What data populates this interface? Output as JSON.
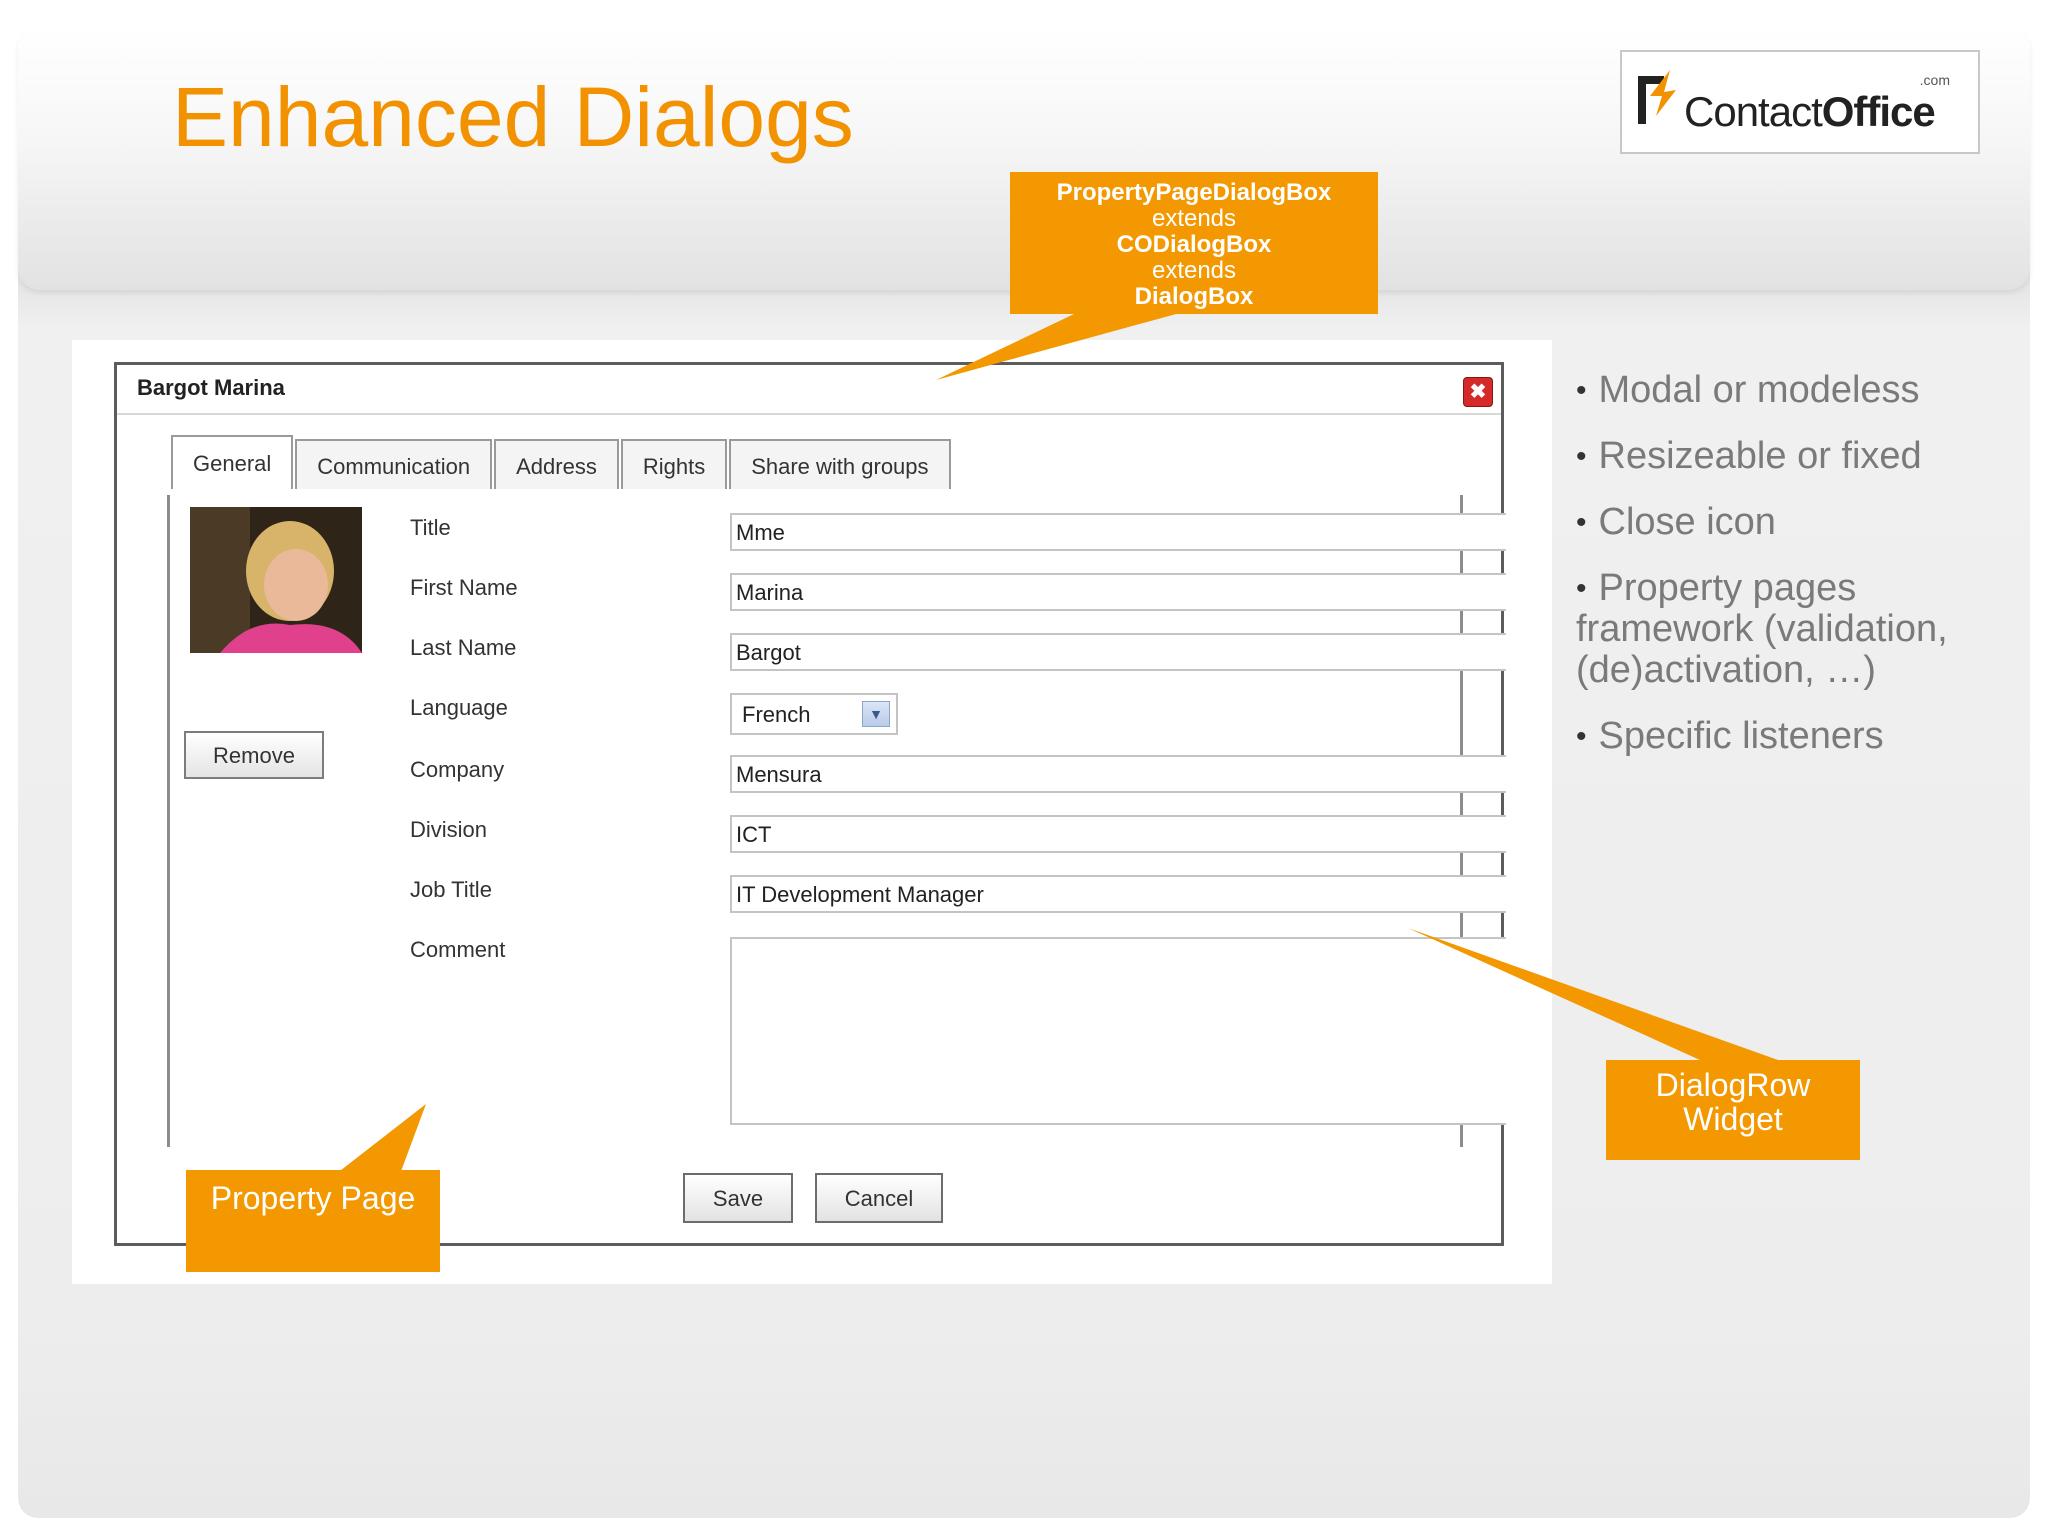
{
  "slide": {
    "title": "Enhanced Dialogs",
    "logo": {
      "name_regular": "Contact",
      "name_bold": "Office",
      "suffix": ".com"
    }
  },
  "callouts": {
    "top": {
      "line1": "PropertyPageDialogBox",
      "line2": "extends",
      "line3": "CODialogBox",
      "line4": "extends",
      "line5": "DialogBox"
    },
    "property_page": "Property Page",
    "dialog_row": {
      "line1": "DialogRow",
      "line2": "Widget"
    }
  },
  "bullets": [
    "Modal or modeless",
    "Resizeable or fixed",
    "Close icon",
    "Property pages framework (validation, (de)activation, …)",
    "Specific listeners"
  ],
  "dialog": {
    "title": "Bargot Marina",
    "close_glyph": "✖",
    "tabs": [
      "General",
      "Communication",
      "Address",
      "Rights",
      "Share with groups"
    ],
    "remove_label": "Remove",
    "fields": {
      "title": {
        "label": "Title",
        "value": "Mme"
      },
      "first_name": {
        "label": "First Name",
        "value": "Marina"
      },
      "last_name": {
        "label": "Last Name",
        "value": "Bargot"
      },
      "language": {
        "label": "Language",
        "value": "French"
      },
      "company": {
        "label": "Company",
        "value": "Mensura"
      },
      "division": {
        "label": "Division",
        "value": "ICT"
      },
      "job_title": {
        "label": "Job Title",
        "value": "IT Development Manager"
      },
      "comment": {
        "label": "Comment",
        "value": ""
      }
    },
    "save_label": "Save",
    "cancel_label": "Cancel"
  },
  "colors": {
    "accent": "#f39200",
    "callout": "#f39800",
    "bullet_text": "#7a7a7a"
  }
}
